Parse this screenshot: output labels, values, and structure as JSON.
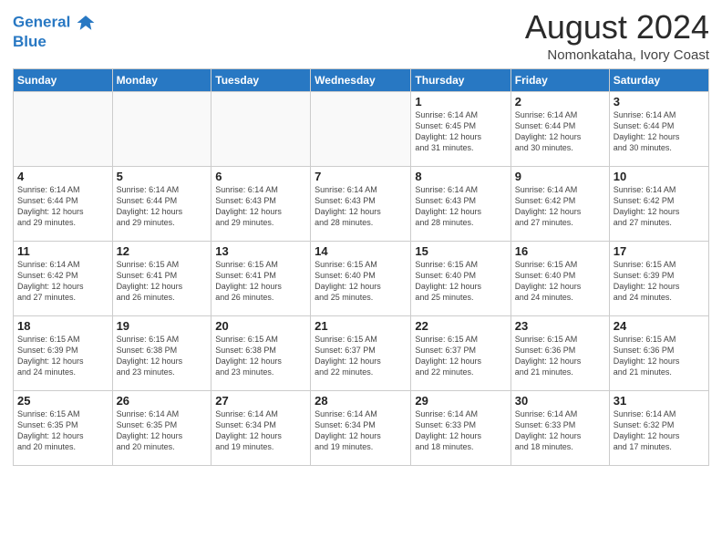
{
  "header": {
    "logo_line1": "General",
    "logo_line2": "Blue",
    "month_year": "August 2024",
    "location": "Nomonkataha, Ivory Coast"
  },
  "weekdays": [
    "Sunday",
    "Monday",
    "Tuesday",
    "Wednesday",
    "Thursday",
    "Friday",
    "Saturday"
  ],
  "weeks": [
    [
      {
        "day": "",
        "info": ""
      },
      {
        "day": "",
        "info": ""
      },
      {
        "day": "",
        "info": ""
      },
      {
        "day": "",
        "info": ""
      },
      {
        "day": "1",
        "info": "Sunrise: 6:14 AM\nSunset: 6:45 PM\nDaylight: 12 hours\nand 31 minutes."
      },
      {
        "day": "2",
        "info": "Sunrise: 6:14 AM\nSunset: 6:44 PM\nDaylight: 12 hours\nand 30 minutes."
      },
      {
        "day": "3",
        "info": "Sunrise: 6:14 AM\nSunset: 6:44 PM\nDaylight: 12 hours\nand 30 minutes."
      }
    ],
    [
      {
        "day": "4",
        "info": "Sunrise: 6:14 AM\nSunset: 6:44 PM\nDaylight: 12 hours\nand 29 minutes."
      },
      {
        "day": "5",
        "info": "Sunrise: 6:14 AM\nSunset: 6:44 PM\nDaylight: 12 hours\nand 29 minutes."
      },
      {
        "day": "6",
        "info": "Sunrise: 6:14 AM\nSunset: 6:43 PM\nDaylight: 12 hours\nand 29 minutes."
      },
      {
        "day": "7",
        "info": "Sunrise: 6:14 AM\nSunset: 6:43 PM\nDaylight: 12 hours\nand 28 minutes."
      },
      {
        "day": "8",
        "info": "Sunrise: 6:14 AM\nSunset: 6:43 PM\nDaylight: 12 hours\nand 28 minutes."
      },
      {
        "day": "9",
        "info": "Sunrise: 6:14 AM\nSunset: 6:42 PM\nDaylight: 12 hours\nand 27 minutes."
      },
      {
        "day": "10",
        "info": "Sunrise: 6:14 AM\nSunset: 6:42 PM\nDaylight: 12 hours\nand 27 minutes."
      }
    ],
    [
      {
        "day": "11",
        "info": "Sunrise: 6:14 AM\nSunset: 6:42 PM\nDaylight: 12 hours\nand 27 minutes."
      },
      {
        "day": "12",
        "info": "Sunrise: 6:15 AM\nSunset: 6:41 PM\nDaylight: 12 hours\nand 26 minutes."
      },
      {
        "day": "13",
        "info": "Sunrise: 6:15 AM\nSunset: 6:41 PM\nDaylight: 12 hours\nand 26 minutes."
      },
      {
        "day": "14",
        "info": "Sunrise: 6:15 AM\nSunset: 6:40 PM\nDaylight: 12 hours\nand 25 minutes."
      },
      {
        "day": "15",
        "info": "Sunrise: 6:15 AM\nSunset: 6:40 PM\nDaylight: 12 hours\nand 25 minutes."
      },
      {
        "day": "16",
        "info": "Sunrise: 6:15 AM\nSunset: 6:40 PM\nDaylight: 12 hours\nand 24 minutes."
      },
      {
        "day": "17",
        "info": "Sunrise: 6:15 AM\nSunset: 6:39 PM\nDaylight: 12 hours\nand 24 minutes."
      }
    ],
    [
      {
        "day": "18",
        "info": "Sunrise: 6:15 AM\nSunset: 6:39 PM\nDaylight: 12 hours\nand 24 minutes."
      },
      {
        "day": "19",
        "info": "Sunrise: 6:15 AM\nSunset: 6:38 PM\nDaylight: 12 hours\nand 23 minutes."
      },
      {
        "day": "20",
        "info": "Sunrise: 6:15 AM\nSunset: 6:38 PM\nDaylight: 12 hours\nand 23 minutes."
      },
      {
        "day": "21",
        "info": "Sunrise: 6:15 AM\nSunset: 6:37 PM\nDaylight: 12 hours\nand 22 minutes."
      },
      {
        "day": "22",
        "info": "Sunrise: 6:15 AM\nSunset: 6:37 PM\nDaylight: 12 hours\nand 22 minutes."
      },
      {
        "day": "23",
        "info": "Sunrise: 6:15 AM\nSunset: 6:36 PM\nDaylight: 12 hours\nand 21 minutes."
      },
      {
        "day": "24",
        "info": "Sunrise: 6:15 AM\nSunset: 6:36 PM\nDaylight: 12 hours\nand 21 minutes."
      }
    ],
    [
      {
        "day": "25",
        "info": "Sunrise: 6:15 AM\nSunset: 6:35 PM\nDaylight: 12 hours\nand 20 minutes."
      },
      {
        "day": "26",
        "info": "Sunrise: 6:14 AM\nSunset: 6:35 PM\nDaylight: 12 hours\nand 20 minutes."
      },
      {
        "day": "27",
        "info": "Sunrise: 6:14 AM\nSunset: 6:34 PM\nDaylight: 12 hours\nand 19 minutes."
      },
      {
        "day": "28",
        "info": "Sunrise: 6:14 AM\nSunset: 6:34 PM\nDaylight: 12 hours\nand 19 minutes."
      },
      {
        "day": "29",
        "info": "Sunrise: 6:14 AM\nSunset: 6:33 PM\nDaylight: 12 hours\nand 18 minutes."
      },
      {
        "day": "30",
        "info": "Sunrise: 6:14 AM\nSunset: 6:33 PM\nDaylight: 12 hours\nand 18 minutes."
      },
      {
        "day": "31",
        "info": "Sunrise: 6:14 AM\nSunset: 6:32 PM\nDaylight: 12 hours\nand 17 minutes."
      }
    ]
  ]
}
